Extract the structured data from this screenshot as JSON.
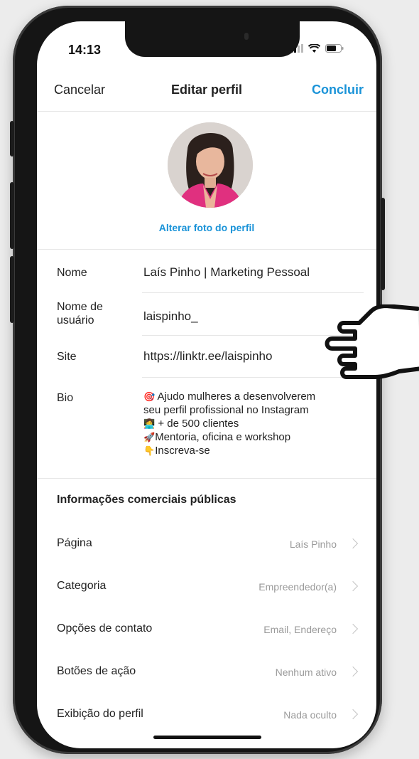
{
  "status": {
    "time": "14:13"
  },
  "nav": {
    "cancel": "Cancelar",
    "title": "Editar perfil",
    "done": "Concluir"
  },
  "profile": {
    "change_photo": "Alterar foto do perfil"
  },
  "fields": {
    "name": {
      "label": "Nome",
      "value": "Laís Pinho | Marketing Pessoal"
    },
    "username": {
      "label_line1": "Nome de",
      "label_line2": "usuário",
      "value": "laispinho_"
    },
    "site": {
      "label": "Site",
      "value": "https://linktr.ee/laispinho"
    },
    "bio": {
      "label": "Bio",
      "lines": [
        {
          "emoji": "🎯",
          "text": "Ajudo mulheres a desenvolverem"
        },
        {
          "emoji": "",
          "text": "seu perfil profissional no Instagram"
        },
        {
          "emoji": "👩‍💻",
          "text": "+ de 500 clientes"
        },
        {
          "emoji": "🚀",
          "text": "Mentoria, oficina e workshop"
        },
        {
          "emoji": "👇",
          "text": "Inscreva-se"
        }
      ]
    }
  },
  "business": {
    "title": "Informações comerciais públicas",
    "rows": [
      {
        "label": "Página",
        "value": "Laís Pinho"
      },
      {
        "label": "Categoria",
        "value": "Empreendedor(a)"
      },
      {
        "label": "Opções de contato",
        "value": "Email, Endereço"
      },
      {
        "label": "Botões de ação",
        "value": "Nenhum ativo"
      },
      {
        "label": "Exibição do perfil",
        "value": "Nada oculto"
      }
    ]
  },
  "colors": {
    "accent": "#1a93d8",
    "secondary_text": "#9a9a9a",
    "avatar_jacket": "#e0307f"
  },
  "icons": [
    "signal-icon",
    "wifi-icon",
    "battery-icon",
    "chevron-right-icon",
    "pointing-hand-icon"
  ]
}
